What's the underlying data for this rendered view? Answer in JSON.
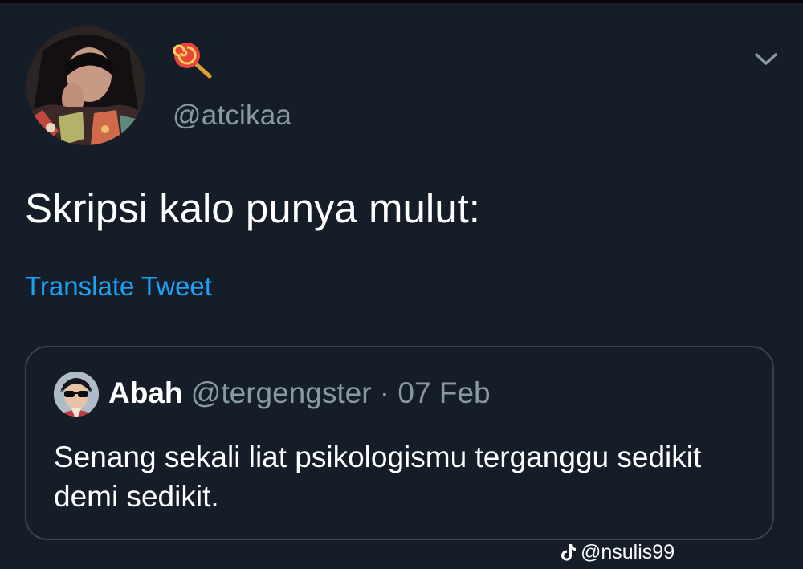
{
  "tweet": {
    "handle": "@atcikaa",
    "emoji_icon": "lollipop-icon",
    "menu_icon": "chevron-down-icon",
    "text": "Skripsi kalo punya mulut:",
    "translate_label": "Translate Tweet"
  },
  "quote": {
    "name": "Abah",
    "handle": "@tergengster",
    "separator": "·",
    "date": "07 Feb",
    "text": "Senang sekali liat psikologismu terganggu sedikit demi sedikit."
  },
  "watermark": {
    "icon": "tiktok-icon",
    "text": "@nsulis99"
  },
  "colors": {
    "background": "#151d29",
    "primary_text": "#ffffff",
    "secondary_text": "#8899a6",
    "link": "#1da1f2",
    "border": "#38444d"
  }
}
